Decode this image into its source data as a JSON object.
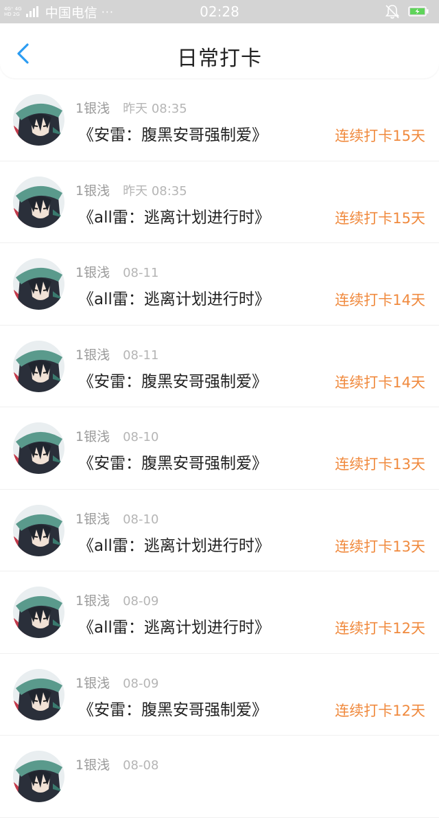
{
  "status_bar": {
    "network_top": "4G⁺ 4G",
    "network_bottom": "HD 2G",
    "carrier": "中国电信",
    "more": "···",
    "time": "02:28",
    "silent_icon": "bell-off-icon",
    "battery_icon": "battery-charging-icon"
  },
  "header": {
    "back_icon": "chevron-left-icon",
    "title": "日常打卡"
  },
  "colors": {
    "accent_blue": "#2b9cf2",
    "streak_orange": "#f08a3e",
    "status_bar_bg": "#d4d4d4"
  },
  "checkins": [
    {
      "user": "1银浅",
      "time": "昨天 08:35",
      "book": "《安雷：腹黑安哥强制爱》",
      "streak": "连续打卡15天"
    },
    {
      "user": "1银浅",
      "time": "昨天 08:35",
      "book": "《all雷：逃离计划进行时》",
      "streak": "连续打卡15天"
    },
    {
      "user": "1银浅",
      "time": "08-11",
      "book": "《all雷：逃离计划进行时》",
      "streak": "连续打卡14天"
    },
    {
      "user": "1银浅",
      "time": "08-11",
      "book": "《安雷：腹黑安哥强制爱》",
      "streak": "连续打卡14天"
    },
    {
      "user": "1银浅",
      "time": "08-10",
      "book": "《安雷：腹黑安哥强制爱》",
      "streak": "连续打卡13天"
    },
    {
      "user": "1银浅",
      "time": "08-10",
      "book": "《all雷：逃离计划进行时》",
      "streak": "连续打卡13天"
    },
    {
      "user": "1银浅",
      "time": "08-09",
      "book": "《all雷：逃离计划进行时》",
      "streak": "连续打卡12天"
    },
    {
      "user": "1银浅",
      "time": "08-09",
      "book": "《安雷：腹黑安哥强制爱》",
      "streak": "连续打卡12天"
    },
    {
      "user": "1银浅",
      "time": "08-08",
      "book": "",
      "streak": ""
    }
  ]
}
